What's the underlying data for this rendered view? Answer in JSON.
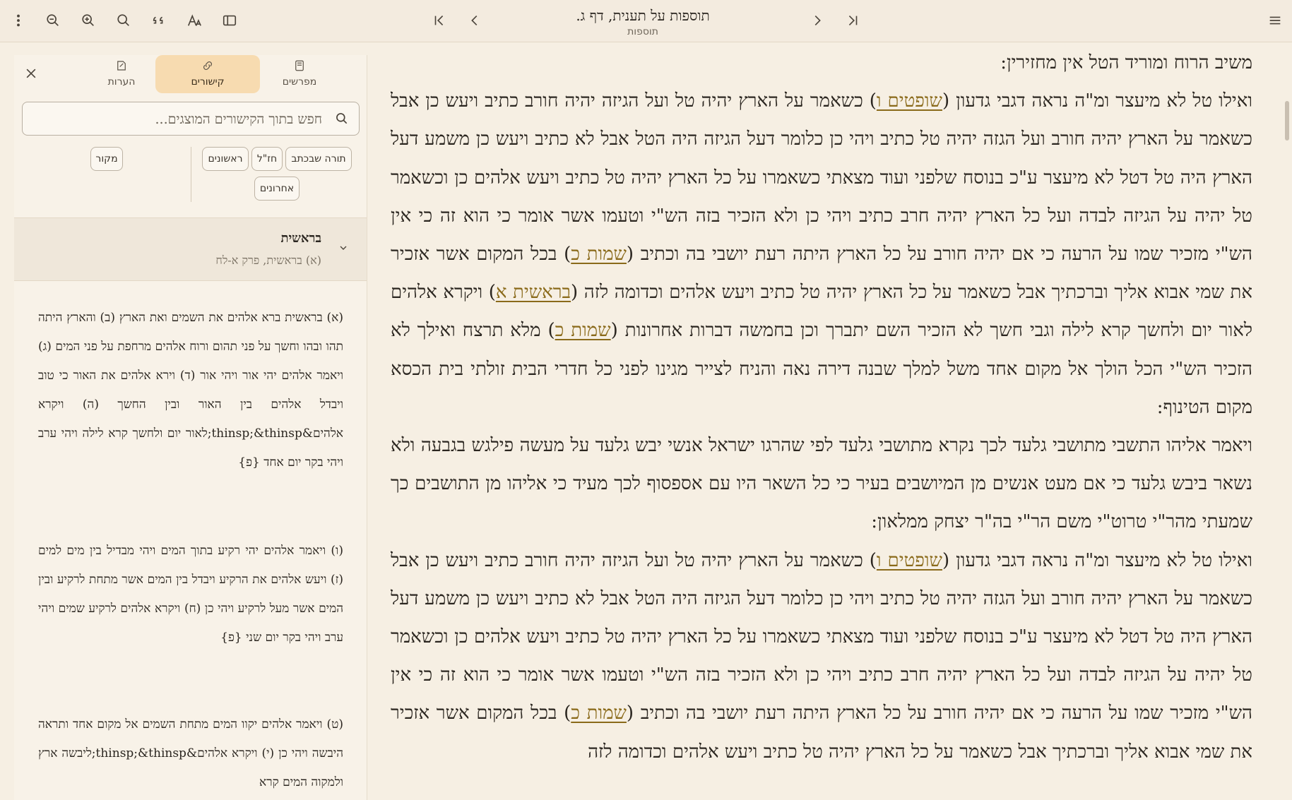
{
  "toolbar": {
    "title": "תוספות על תענית, דף ג.",
    "subtitle": "תוספות"
  },
  "panel": {
    "tabs": [
      {
        "label": "מפרשים"
      },
      {
        "label": "קישורים"
      },
      {
        "label": "הערות"
      }
    ],
    "search_placeholder": "חפש בתוך הקישורים המוצגים...",
    "chips": {
      "torah": "תורה שבכתב",
      "chazal": "חז\"ל",
      "rishonim": "ראשונים",
      "acharonim": "אחרונים",
      "makor": "מקור"
    },
    "section": {
      "title": "בראשית",
      "subtitle": "(א) בראשית, פרק א-לח"
    },
    "verses": [
      "(א) בראשית ברא אלהים את השמים ואת הארץ (ב) והארץ היתה תהו ובהו וחשך על פני תהום ורוח אלהים מרחפת על פני המים (ג) ויאמר אלהים יהי אור ויהי אור (ד) וירא אלהים את האור כי טוב ויבדל אלהים בין האור ובין החשך (ה) ויקרא אלהים&thinsp;&thinsp;לאור יום ולחשך קרא לילה ויהי ערב ויהי בקר יום אחד {פ}",
      "(ו) ויאמר אלהים יהי רקיע בתוך המים ויהי מבדיל בין מים למים (ז) ויעש אלהים את הרקיע ויבדל בין המים אשר מתחת לרקיע ובין המים אשר מעל לרקיע ויהי כן (ח) ויקרא אלהים לרקיע שמים ויהי ערב ויהי בקר יום שני {פ}",
      "(ט) ויאמר אלהים יקוו המים מתחת השמים אל מקום אחד ותראה היבשה ויהי כן (י) ויקרא אלהים&thinsp;&thinsp;ליבשה ארץ ולמקוה המים קרא"
    ]
  },
  "main": {
    "p1": "משיב הרוח ומוריד הטל אין מחזירין:",
    "p2": [
      {
        "t": "ואילו טל לא מיעצר ומ\"ה נראה דגבי גדעון ("
      },
      {
        "t": "שופטים ו",
        "ref": true
      },
      {
        "t": ") כשאמר על הארץ יהיה טל ועל הגיזה יהיה חורב כתיב ויעש כן אבל כשאמר על הארץ יהיה חורב ועל הגזה יהיה טל כתיב ויהי כן כלומר דעל הגיזה היה הטל אבל לא כתיב ויעש כן משמע דעל הארץ היה טל דטל לא מיעצר ע\"כ בנוסח שלפני ועוד מצאתי כשאמרו על כל הארץ יהיה טל כתיב ויעש אלהים כן וכשאמר טל יהיה על הגיזה לבדה ועל כל הארץ יהיה חרב כתיב ויהי כן ולא הזכיר בזה הש\"י וטעמו אשר אומר כי הוא זה כי אין הש\"י מזכיר שמו על הרעה כי אם יהיה חורב על כל הארץ היתה רעת יושבי בה וכתיב ("
      },
      {
        "t": "שמות כ",
        "ref": true
      },
      {
        "t": ") בכל המקום אשר אזכיר את שמי אבוא אליך וברכתיך אבל כשאמר על כל הארץ יהיה טל כתיב ויעש אלהים וכדומה לזה ("
      },
      {
        "t": "בראשית א",
        "ref": true
      },
      {
        "t": ") ויקרא אלהים לאור יום ולחשך קרא לילה וגבי חשך לא הזכיר השם יתברך וכן בחמשה דברות אחרונות ("
      },
      {
        "t": "שמות כ",
        "ref": true
      },
      {
        "t": ") מלא תרצח ואילך לא הזכיר הש\"י הכל הולך אל מקום אחד משל למלך שבנה דירה נאה והניח לצייר מגינו לפני כל חדרי הבית זולתי בית הכסא מקום הטינוף:"
      }
    ],
    "p3": "ויאמר אליהו התשבי מתושבי גלעד לכך נקרא מתושבי גלעד לפי שהרגו ישראל אנשי יבש גלעד על מעשה פילגש בגבעה ולא נשאר ביבש גלעד כי אם מעט אנשים מן המיושבים בעיר כי כל השאר היו עם אספסוף לכך מעיד כי אליהו מן התושבים כך שמעתי מהר\"י טרוט\"י משם הר\"י בה\"ר יצחק ממלאון:",
    "p4": [
      {
        "t": "ואילו טל לא מיעצר ומ\"ה נראה דגבי גדעון ("
      },
      {
        "t": "שופטים ו",
        "ref": true
      },
      {
        "t": ") כשאמר על הארץ יהיה טל ועל הגיזה יהיה חורב כתיב ויעש כן אבל כשאמר על הארץ יהיה חורב ועל הגזה יהיה טל כתיב ויהי כן כלומר דעל הגיזה היה הטל אבל לא כתיב ויעש כן משמע דעל הארץ היה טל דטל לא מיעצר ע\"כ בנוסח שלפני ועוד מצאתי כשאמרו על כל הארץ יהיה טל כתיב ויעש אלהים כן וכשאמר טל יהיה על הגיזה לבדה ועל כל הארץ יהיה חרב כתיב ויהי כן ולא הזכיר בזה הש\"י וטעמו אשר אומר כי הוא זה כי אין הש\"י מזכיר שמו על הרעה כי אם יהיה חורב על כל הארץ היתה רעת יושבי בה וכתיב ("
      },
      {
        "t": "שמות כ",
        "ref": true
      },
      {
        "t": ") בכל המקום אשר אזכיר את שמי אבוא אליך וברכתיך אבל כשאמר על כל הארץ יהיה טל כתיב ויעש אלהים וכדומה לזה"
      }
    ]
  }
}
